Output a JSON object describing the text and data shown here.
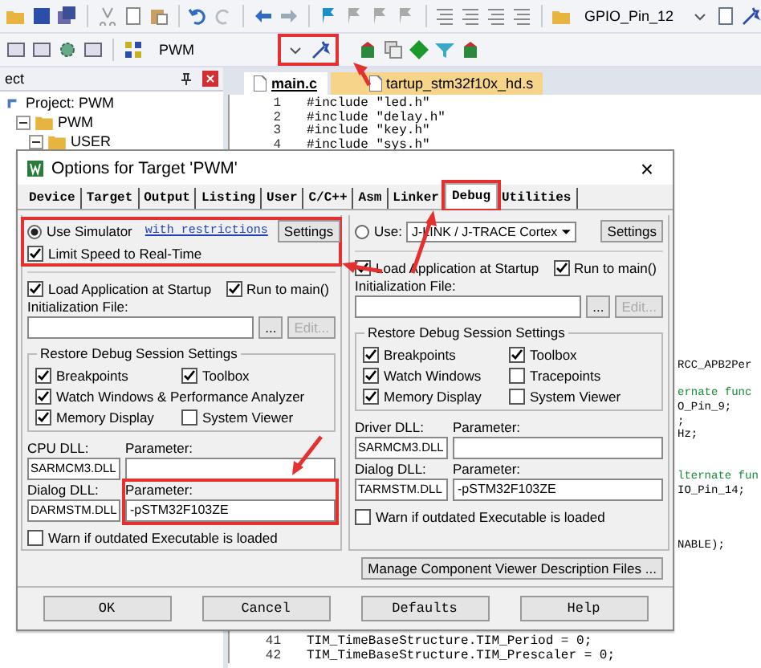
{
  "toolbar_top": {
    "combo": "GPIO_Pin_12"
  },
  "toolbar_bottom": {
    "target": "PWM",
    "options_highlighted": true
  },
  "project_panel": {
    "title": "ect",
    "tree": [
      {
        "label": "Project: PWM",
        "children": [
          {
            "label": "PWM",
            "expanded": true,
            "children": [
              {
                "label": "USER",
                "expanded": true
              }
            ]
          }
        ]
      }
    ]
  },
  "editor": {
    "tabs": [
      {
        "label": "main.c",
        "selected": true
      },
      {
        "label": "tartup_stm32f10x_hd.s",
        "selected": false
      }
    ],
    "lines": [
      {
        "kind": "full",
        "number": "1",
        "text": "#include \"led.h\""
      },
      {
        "kind": "full",
        "number": "2",
        "text": "#include \"delay.h\""
      },
      {
        "kind": "full",
        "number": "3",
        "text": "#include \"key.h\""
      },
      {
        "kind": "full",
        "number": "4",
        "text": "#include \"sys.h\""
      },
      {
        "kind": "blank"
      },
      {
        "kind": "blank"
      },
      {
        "kind": "blank"
      },
      {
        "kind": "blank"
      },
      {
        "kind": "blank"
      },
      {
        "kind": "blank"
      },
      {
        "kind": "blank"
      },
      {
        "kind": "blank"
      },
      {
        "kind": "blank"
      },
      {
        "kind": "blank"
      },
      {
        "kind": "blank"
      },
      {
        "kind": "blank"
      },
      {
        "kind": "blank"
      },
      {
        "kind": "blank"
      },
      {
        "kind": "blank"
      },
      {
        "kind": "tail",
        "text": "RCC_APB2Per"
      },
      {
        "kind": "blank"
      },
      {
        "kind": "comment",
        "text": "ernate func"
      },
      {
        "kind": "tail",
        "text": "O_Pin_9;"
      },
      {
        "kind": "tail",
        "text": ";"
      },
      {
        "kind": "tail",
        "text": "Hz;"
      },
      {
        "kind": "blank"
      },
      {
        "kind": "blank"
      },
      {
        "kind": "comment",
        "text": "lternate fun"
      },
      {
        "kind": "tail",
        "text": "IO_Pin_14;"
      },
      {
        "kind": "blank"
      },
      {
        "kind": "blank"
      },
      {
        "kind": "blank"
      },
      {
        "kind": "tail",
        "text": "NABLE);"
      },
      {
        "kind": "blank"
      },
      {
        "kind": "blank"
      },
      {
        "kind": "blank"
      },
      {
        "kind": "blank"
      },
      {
        "kind": "blank"
      },
      {
        "kind": "blank"
      },
      {
        "kind": "full",
        "number": "41",
        "text": "TIM_TimeBaseStructure.TIM_Period = 0;"
      },
      {
        "kind": "full",
        "number": "42",
        "text": "TIM_TimeBaseStructure.TIM_Prescaler = 0;"
      }
    ]
  },
  "dialog": {
    "title": "Options for Target 'PWM'",
    "close": "×",
    "tabs": [
      {
        "label": "Device",
        "selected": false,
        "highlighted": false
      },
      {
        "label": "Target",
        "selected": false,
        "highlighted": false
      },
      {
        "label": "Output",
        "selected": false,
        "highlighted": false
      },
      {
        "label": "Listing",
        "selected": false,
        "highlighted": false
      },
      {
        "label": "User",
        "selected": false,
        "highlighted": false
      },
      {
        "label": "C/C++",
        "selected": false,
        "highlighted": false
      },
      {
        "label": "Asm",
        "selected": false,
        "highlighted": false
      },
      {
        "label": "Linker",
        "selected": false,
        "highlighted": false
      },
      {
        "label": "Debug",
        "selected": true,
        "highlighted": true
      },
      {
        "label": "Utilities",
        "selected": false,
        "highlighted": false
      }
    ],
    "columns": [
      {
        "kind": "simulator",
        "target": {
          "label": "Use Simulator",
          "selected": true,
          "link": "with restrictions"
        },
        "highlighted": true,
        "settings_button": "Settings",
        "limit_speed": {
          "label": "Limit Speed to Real-Time",
          "checked": true
        },
        "load_app": {
          "label": "Load Application at Startup",
          "checked": true
        },
        "run_to_main": {
          "label": "Run to main()",
          "checked": true
        },
        "init_label": "Initialization File:",
        "browse_button": "...",
        "edit_button": {
          "label": "Edit...",
          "disabled": true
        },
        "restore": {
          "title": "Restore Debug Session Settings",
          "rows": [
            [
              {
                "label": "Breakpoints",
                "checked": true
              },
              {
                "label": "Toolbox",
                "checked": true
              }
            ],
            [
              {
                "label": "Watch Windows & Performance Analyzer",
                "checked": true
              }
            ],
            [
              {
                "label": "Memory Display",
                "checked": true
              },
              {
                "label": "System Viewer",
                "checked": false
              }
            ]
          ]
        },
        "dll_rows": [
          {
            "label": "CPU DLL:",
            "value": "SARMCM3.DLL",
            "param_label": "Parameter:",
            "highlighted": false
          },
          {
            "label": "Dialog DLL:",
            "value": "DARMSTM.DLL",
            "param_label": "Parameter:",
            "param": "-pSTM32F103ZE",
            "highlighted": true
          }
        ],
        "warn": {
          "label": "Warn if outdated Executable is loaded",
          "checked": false
        }
      },
      {
        "kind": "driver",
        "target": {
          "label": "Use:",
          "selected": false,
          "driver": "J-LINK / J-TRACE Cortex"
        },
        "highlighted": false,
        "settings_button": "Settings",
        "load_app": {
          "label": "Load Application at Startup",
          "checked": true
        },
        "run_to_main": {
          "label": "Run to main()",
          "checked": true
        },
        "init_label": "Initialization File:",
        "browse_button": "...",
        "edit_button": {
          "label": "Edit...",
          "disabled": true
        },
        "restore": {
          "title": "Restore Debug Session Settings",
          "rows": [
            [
              {
                "label": "Breakpoints",
                "checked": true
              },
              {
                "label": "Toolbox",
                "checked": true
              }
            ],
            [
              {
                "label": "Watch Windows",
                "checked": true
              },
              {
                "label": "Tracepoints",
                "checked": false
              }
            ],
            [
              {
                "label": "Memory Display",
                "checked": true
              },
              {
                "label": "System Viewer",
                "checked": false
              }
            ]
          ]
        },
        "dll_rows": [
          {
            "label": "Driver DLL:",
            "value": "SARMCM3.DLL",
            "param_label": "Parameter:",
            "highlighted": false
          },
          {
            "label": "Dialog DLL:",
            "value": "TARMSTM.DLL",
            "param_label": "Parameter:",
            "param": "-pSTM32F103ZE",
            "highlighted": false
          }
        ],
        "warn": {
          "label": "Warn if outdated Executable is loaded",
          "checked": false
        }
      }
    ],
    "manage_button": "Manage Component Viewer Description Files ...",
    "buttons": [
      "OK",
      "Cancel",
      "Defaults",
      "Help"
    ]
  }
}
